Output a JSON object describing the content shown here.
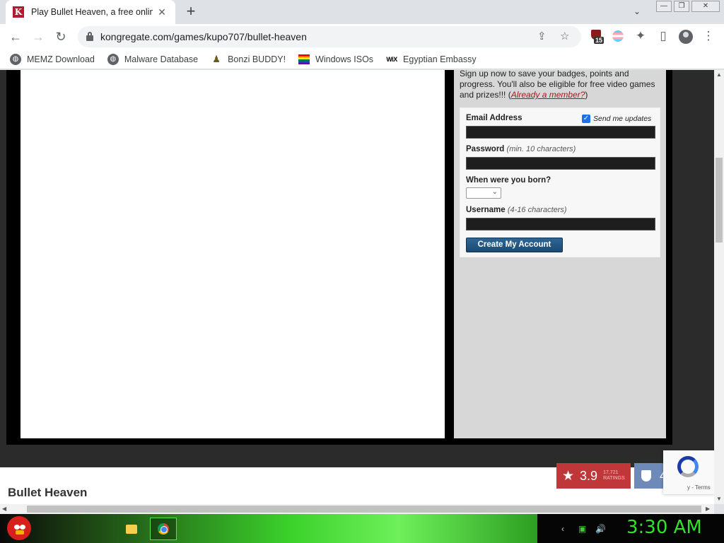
{
  "browser": {
    "tab": {
      "favicon_letter": "K",
      "title": "Play Bullet Heaven, a free online game on Kongregate",
      "close": "✕"
    },
    "new_tab": "+",
    "tab_search": "⌄",
    "window_controls": {
      "minimize": "—",
      "maximize": "❐",
      "close": "✕"
    },
    "nav": {
      "back": "←",
      "forward": "→",
      "reload": "↻"
    },
    "url": "kongregate.com/games/kupo707/bullet-heaven",
    "omnibox_icons": {
      "share": "⇪",
      "bookmark": "☆"
    },
    "extensions": {
      "shield_badge": "15",
      "puzzle": "✦",
      "sidepanel": "▯",
      "menu": "⋮"
    }
  },
  "bookmarks": [
    {
      "label": "MEMZ Download",
      "icon": "globe-icon"
    },
    {
      "label": "Malware Database",
      "icon": "globe-icon"
    },
    {
      "label": "Bonzi BUDDY!",
      "icon": "bonzi-icon"
    },
    {
      "label": "Windows ISOs",
      "icon": "rainbow-flag-icon"
    },
    {
      "label": "Egyptian Embassy",
      "icon": "wix-icon",
      "icon_text": "WiX"
    }
  ],
  "signup": {
    "intro_text": "Sign up now to save your badges, points and progress. You'll also be eligible for free video games and prizes!!! (",
    "member_link": "Already a member?",
    "intro_close": ")",
    "email_label": "Email Address",
    "updates_label": "Send me updates",
    "updates_checked": true,
    "password_label": "Password",
    "password_hint": "(min. 10 characters)",
    "birth_label": "When were you born?",
    "birth_value": "",
    "username_label": "Username",
    "username_hint": "(4-16 characters)",
    "create_button": "Create My Account"
  },
  "game": {
    "title": "Bullet Heaven",
    "rating": "3.9",
    "ratings_count": "17,721",
    "ratings_label": "RATINGS",
    "badges": "4"
  },
  "recaptcha": {
    "terms": "y - Terms"
  },
  "taskbar": {
    "clock": "3:30 AM",
    "apps": [
      "start-button",
      "file-explorer",
      "chrome"
    ]
  },
  "colors": {
    "kongregate_red": "#b3182e",
    "rating_red": "#c0373a",
    "badge_blue": "#6e8ab8",
    "create_button_blue": "#1a4a73",
    "taskbar_green": "#3bd12b",
    "clock_green": "#33e02a"
  }
}
